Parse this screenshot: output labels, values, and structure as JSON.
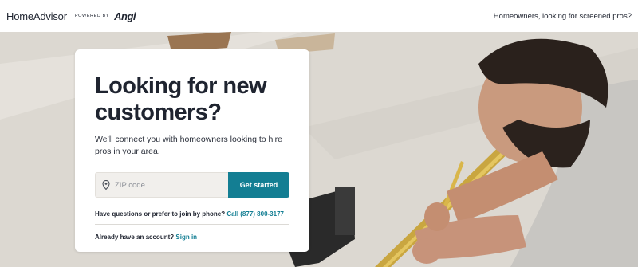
{
  "header": {
    "logo_text": "HomeAdvisor",
    "powered_by": "POWERED BY",
    "brand": "Angi",
    "right_link": "Homeowners, looking for screened pros?"
  },
  "card": {
    "title": "Looking for new customers?",
    "subtitle": "We’ll connect you with homeowners looking to hire pros in your area.",
    "zip_placeholder": "ZIP code",
    "zip_value": "",
    "cta_label": "Get started",
    "phone_prompt": "Have questions or prefer to join by phone?",
    "phone_link": "Call (877) 800-3177",
    "signin_prompt": "Already have an account?",
    "signin_link": "Sign in"
  },
  "icons": {
    "zip_icon": "map-pin-icon"
  },
  "colors": {
    "accent": "#137e93",
    "text": "#1f2430",
    "card_bg": "#ffffff"
  }
}
